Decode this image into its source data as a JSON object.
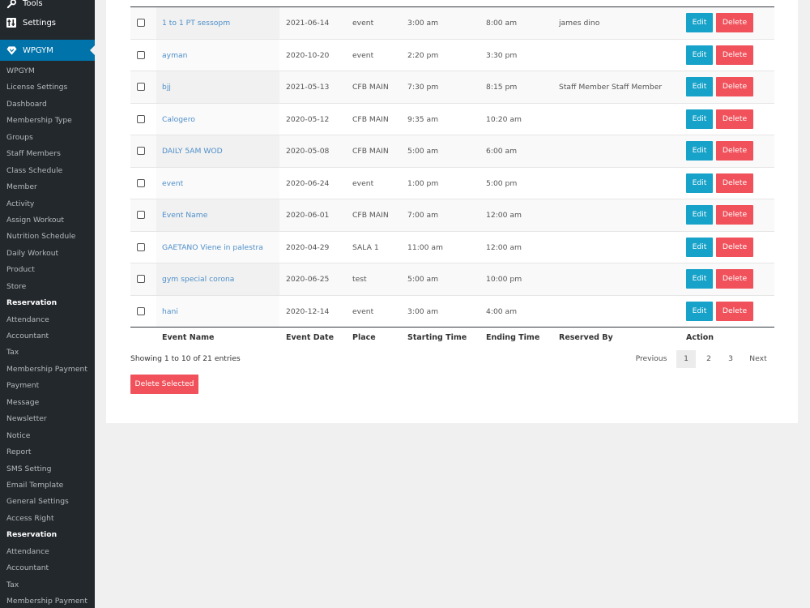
{
  "sidebar": {
    "tools_label": "Tools",
    "settings_label": "Settings",
    "wpgym_label": "WPGYM",
    "submenu": [
      "WPGYM",
      "License Settings",
      "Dashboard",
      "Membership Type",
      "Groups",
      "Staff Members",
      "Class Schedule",
      "Member",
      "Activity",
      "Assign Workout",
      "Nutrition Schedule",
      "Daily Workout",
      "Product",
      "Store",
      "Reservation",
      "Attendance",
      "Accountant",
      "Tax",
      "Membership Payment",
      "Payment",
      "Message",
      "Newsletter",
      "Notice",
      "Report",
      "SMS Setting",
      "Email Template",
      "General Settings",
      "Access Right",
      "Reservation",
      "Attendance",
      "Accountant",
      "Tax",
      "Membership Payment"
    ],
    "current_item": "Reservation"
  },
  "table": {
    "columns": {
      "name": "Event Name",
      "date": "Event Date",
      "place": "Place",
      "start": "Starting Time",
      "end": "Ending Time",
      "by": "Reserved By",
      "action": "Action"
    },
    "edit_label": "Edit",
    "delete_label": "Delete",
    "rows": [
      {
        "name": "1 to 1 PT sessopm",
        "date": "2021-06-14",
        "place": "event",
        "start": "3:00 am",
        "end": "8:00 am",
        "by": "james dino"
      },
      {
        "name": "ayman",
        "date": "2020-10-20",
        "place": "event",
        "start": "2:20 pm",
        "end": "3:30 pm",
        "by": ""
      },
      {
        "name": "bjj",
        "date": "2021-05-13",
        "place": "CFB MAIN",
        "start": "7:30 pm",
        "end": "8:15 pm",
        "by": "Staff Member Staff Member"
      },
      {
        "name": "Calogero",
        "date": "2020-05-12",
        "place": "CFB MAIN",
        "start": "9:35 am",
        "end": "10:20 am",
        "by": ""
      },
      {
        "name": "DAILY 5AM WOD",
        "date": "2020-05-08",
        "place": "CFB MAIN",
        "start": "5:00 am",
        "end": "6:00 am",
        "by": ""
      },
      {
        "name": "event",
        "date": "2020-06-24",
        "place": "event",
        "start": "1:00 pm",
        "end": "5:00 pm",
        "by": ""
      },
      {
        "name": "Event Name",
        "date": "2020-06-01",
        "place": "CFB MAIN",
        "start": "7:00 am",
        "end": "12:00 am",
        "by": ""
      },
      {
        "name": "GAETANO Viene in palestra",
        "date": "2020-04-29",
        "place": "SALA 1",
        "start": "11:00 am",
        "end": "12:00 am",
        "by": ""
      },
      {
        "name": "gym special corona",
        "date": "2020-06-25",
        "place": "test",
        "start": "5:00 am",
        "end": "10:00 pm",
        "by": ""
      },
      {
        "name": "hani",
        "date": "2020-12-14",
        "place": "event",
        "start": "3:00 am",
        "end": "4:00 am",
        "by": ""
      }
    ]
  },
  "info_text": "Showing 1 to 10 of 21 entries",
  "pagination": {
    "previous": "Previous",
    "pages": [
      "1",
      "2",
      "3"
    ],
    "active": "1",
    "next": "Next"
  },
  "delete_selected_label": "Delete Selected"
}
